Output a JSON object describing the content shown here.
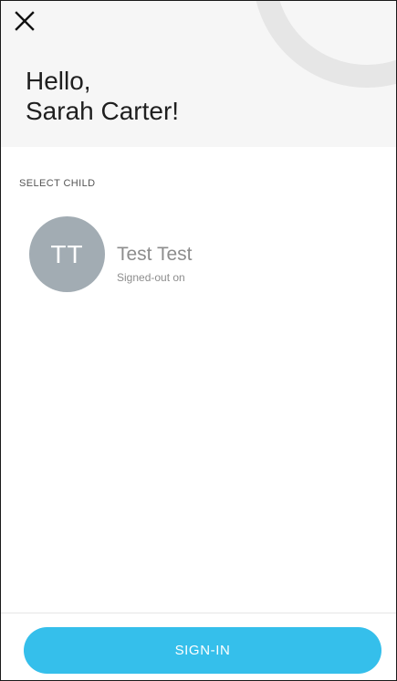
{
  "header": {
    "close_icon": "close-icon",
    "greeting_line1": "Hello,",
    "greeting_line2": "Sarah Carter!"
  },
  "children_section": {
    "label": "SELECT CHILD",
    "children": [
      {
        "initials": "TT",
        "name": "Test Test",
        "status": "Signed-out on"
      }
    ]
  },
  "footer": {
    "signin_label": "SIGN-IN"
  },
  "colors": {
    "accent": "#35bfeb",
    "avatar_bg": "#a2acb3",
    "header_bg": "#f6f6f6",
    "decoration": "#e6e6e6"
  }
}
